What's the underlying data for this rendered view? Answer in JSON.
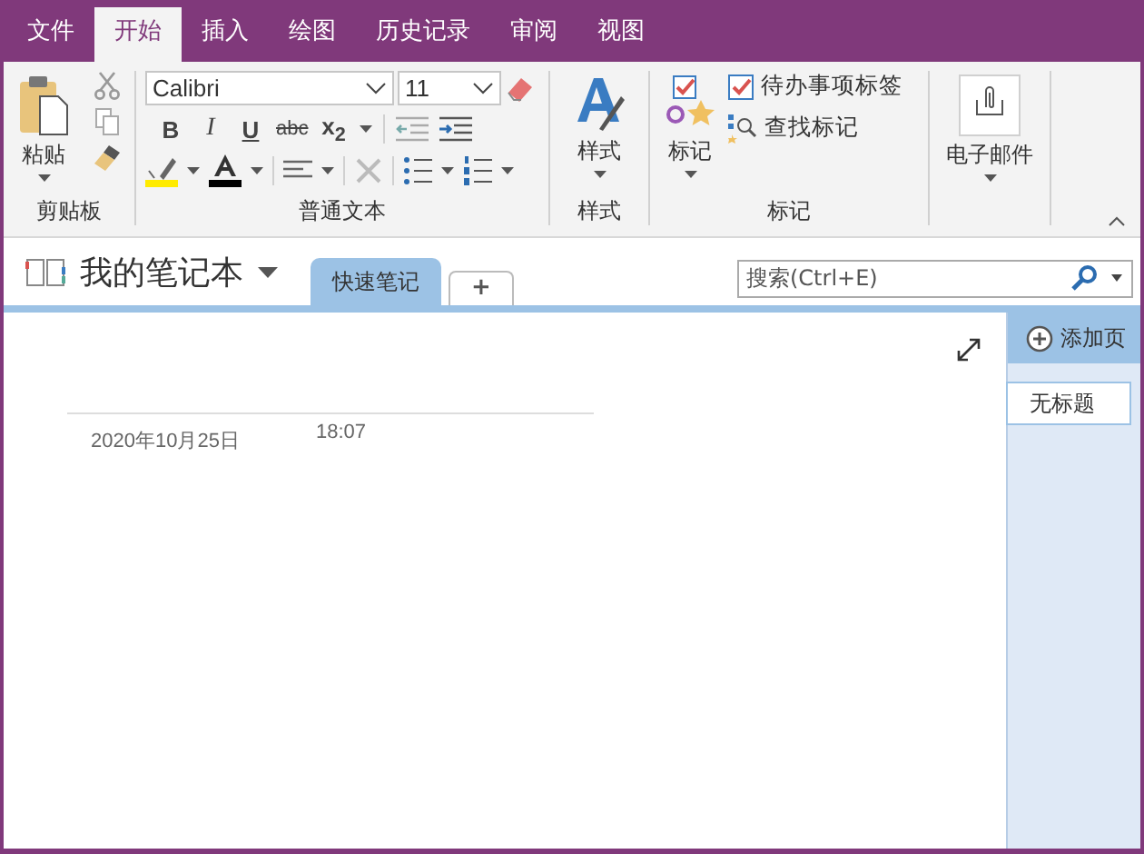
{
  "menu_tabs": [
    {
      "label": "文件",
      "selected": false
    },
    {
      "label": "开始",
      "selected": true
    },
    {
      "label": "插入",
      "selected": false
    },
    {
      "label": "绘图",
      "selected": false
    },
    {
      "label": "历史记录",
      "selected": false
    },
    {
      "label": "审阅",
      "selected": false
    },
    {
      "label": "视图",
      "selected": false
    }
  ],
  "ribbon": {
    "clipboard": {
      "paste": "粘贴",
      "group": "剪贴板"
    },
    "basic_text": {
      "font": "Calibri",
      "size": "11",
      "group": "普通文本",
      "format_buttons": [
        {
          "kind": "bold",
          "label": "B"
        },
        {
          "kind": "italic",
          "label": "I"
        },
        {
          "kind": "underline",
          "label": "U"
        },
        {
          "kind": "strike",
          "label": "abc"
        },
        {
          "kind": "subscript",
          "label": "x$_{2}$"
        }
      ]
    },
    "styles": {
      "button": "样式",
      "group": "样式"
    },
    "tags": {
      "button": "标记",
      "todo": "待办事项标签",
      "find": "查找标记",
      "group": "标记"
    },
    "email": {
      "button": "电子邮件"
    }
  },
  "notebook": {
    "name": "我的笔记本",
    "sections": [
      {
        "label": "快速笔记",
        "selected": true
      }
    ],
    "add_section": "+"
  },
  "search": {
    "placeholder": "搜索(Ctrl+E)"
  },
  "page": {
    "date": "2020年10月25日",
    "time": "18:07"
  },
  "pages_panel": {
    "add_page": "添加页",
    "pages": [
      {
        "title": "无标题",
        "selected": true
      }
    ]
  }
}
